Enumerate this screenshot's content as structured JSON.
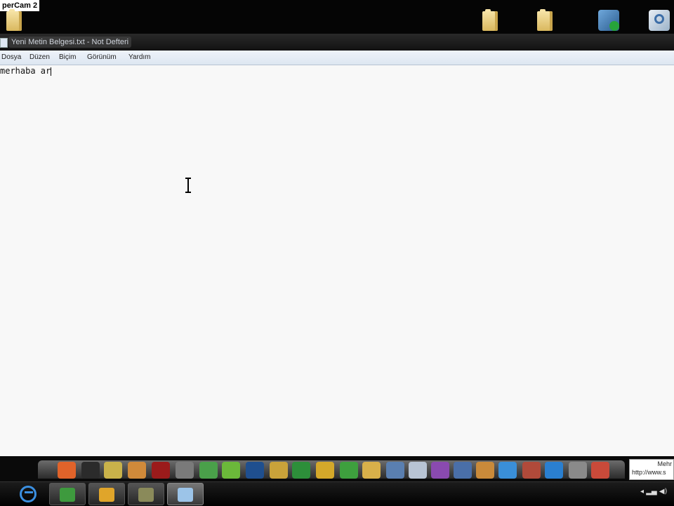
{
  "screen_label": "perCam 2",
  "window": {
    "title": "Yeni Metin Belgesi.txt - Not Defteri",
    "menu": [
      "Dosya",
      "Düzen",
      "Biçim",
      "Görünüm",
      "Yardım"
    ],
    "text": "merhaba ar"
  },
  "notification": {
    "line1": "Mehr",
    "line2": "http://www.s"
  },
  "colors": {
    "titlebar": "#1a1a1a",
    "menubar": "#e4ecf6",
    "editor_bg": "#f8f8f8",
    "taskbar": "#0e0e0e"
  },
  "icons": {
    "desktop": [
      "folder-icon",
      "folder-icon",
      "folder-icon",
      "tools-app-icon",
      "search-app-icon"
    ],
    "taskbar": [
      "start-orb-icon",
      "internet-explorer-icon",
      "messenger-icon",
      "power-app-icon",
      "fireworks-icon",
      "notepad-icon"
    ],
    "tray": [
      "show-hidden-icon",
      "network-icon",
      "volume-icon"
    ]
  }
}
